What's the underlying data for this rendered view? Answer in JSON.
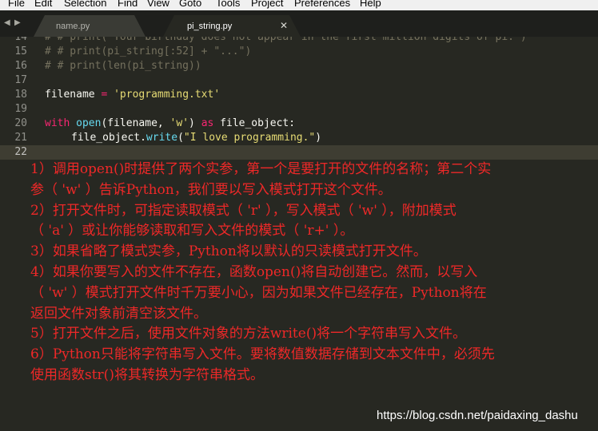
{
  "menu": [
    "File",
    "Edit",
    "Selection",
    "Find",
    "View",
    "Goto",
    "Tools",
    "Project",
    "Preferences",
    "Help"
  ],
  "tabs": [
    {
      "label": "name.py",
      "active": false
    },
    {
      "label": "pi_string.py",
      "active": true
    }
  ],
  "tab_close_glyph": "✕",
  "nav_glyphs": {
    "back": "◀",
    "forward": "▶"
  },
  "code_lines": [
    {
      "num": "14",
      "segments": [
        {
          "text": "# # print(\"Your birthday does not appear in the first million digits of pi.\")",
          "cls": "cmt"
        }
      ]
    },
    {
      "num": "15",
      "segments": [
        {
          "text": "# # print(pi_string[:52] + \"...\")",
          "cls": "cmt"
        }
      ]
    },
    {
      "num": "16",
      "segments": [
        {
          "text": "# # print(len(pi_string))",
          "cls": "cmt"
        }
      ]
    },
    {
      "num": "17",
      "segments": []
    },
    {
      "num": "18",
      "segments": [
        {
          "text": "filename ",
          "cls": ""
        },
        {
          "text": "=",
          "cls": "kw"
        },
        {
          "text": " ",
          "cls": ""
        },
        {
          "text": "'programming.txt'",
          "cls": "str"
        }
      ]
    },
    {
      "num": "19",
      "segments": []
    },
    {
      "num": "20",
      "segments": [
        {
          "text": "with",
          "cls": "kw"
        },
        {
          "text": " ",
          "cls": ""
        },
        {
          "text": "open",
          "cls": "fn"
        },
        {
          "text": "(filename, ",
          "cls": ""
        },
        {
          "text": "'w'",
          "cls": "str"
        },
        {
          "text": ") ",
          "cls": ""
        },
        {
          "text": "as",
          "cls": "kw"
        },
        {
          "text": " file_object:",
          "cls": ""
        }
      ]
    },
    {
      "num": "21",
      "indent": true,
      "segments": [
        {
          "text": "file_object.",
          "cls": ""
        },
        {
          "text": "write",
          "cls": "fn"
        },
        {
          "text": "(",
          "cls": ""
        },
        {
          "text": "\"I love programming.\"",
          "cls": "str"
        },
        {
          "text": ")",
          "cls": ""
        }
      ]
    },
    {
      "num": "22",
      "current": true,
      "segments": []
    }
  ],
  "annotations": [
    "1）调用open()时提供了两个实参，第一个是要打开的文件的名称；第二个实",
    "参（ 'w' ）告诉Python，我们要以写入模式打开这个文件。",
    "2）打开文件时，可指定读取模式（ 'r' ），写入模式（ 'w' ），附加模式",
    "（ 'a' ）或让你能够读取和写入文件的模式（ 'r+' ）。",
    "3）如果省略了模式实参，Python将以默认的只读模式打开文件。",
    "4）如果你要写入的文件不存在，函数open()将自动创建它。然而，以写入",
    "（ 'w' ）模式打开文件时千万要小心，因为如果文件已经存在，Python将在",
    "返回文件对象前清空该文件。",
    "5）打开文件之后，使用文件对象的方法write()将一个字符串写入文件。",
    "6）Python只能将字符串写入文件。要将数值数据存储到文本文件中，必须先",
    "使用函数str()将其转换为字符串格式。"
  ],
  "watermark": "https://blog.csdn.net/paidaxing_dashu",
  "colors": {
    "editor_bg": "#272822",
    "tab_active": "#272822",
    "tab_inactive": "#3a3b35",
    "annotation_red": "#ee2828",
    "comment": "#75715e",
    "string": "#e6db74",
    "keyword": "#f92672",
    "function": "#66d9ef"
  }
}
